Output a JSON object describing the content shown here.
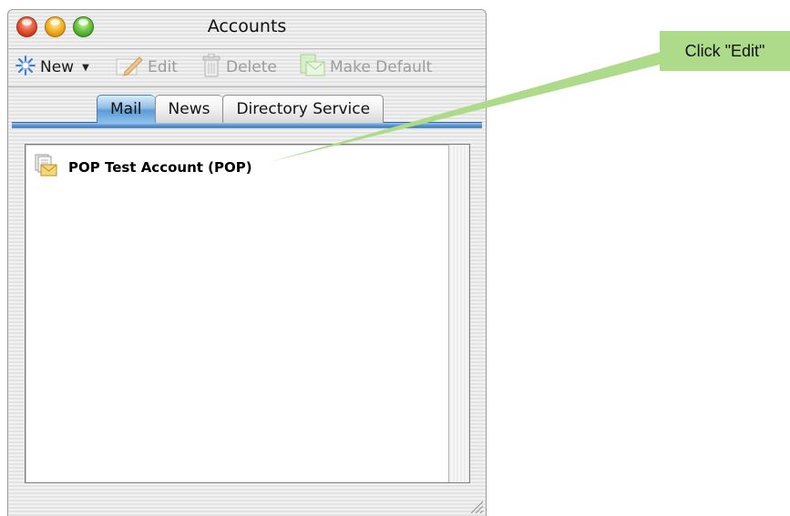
{
  "window": {
    "title": "Accounts"
  },
  "toolbar": {
    "new_label": "New",
    "edit_label": "Edit",
    "delete_label": "Delete",
    "make_default_label": "Make Default",
    "new_icon": "new-sparkle-icon",
    "edit_icon": "edit-icon",
    "delete_icon": "trash-icon",
    "make_default_icon": "make-default-icon"
  },
  "tabs": [
    {
      "label": "Mail",
      "active": true
    },
    {
      "label": "News",
      "active": false
    },
    {
      "label": "Directory Service",
      "active": false
    }
  ],
  "accounts": [
    {
      "name": "POP Test Account (POP)",
      "icon": "mail-account-icon"
    }
  ],
  "annotation": {
    "text": "Click \"Edit\"",
    "color": "#addb8a"
  },
  "colors": {
    "tab_accent": "#5d9cd5",
    "callout": "#addb8a"
  }
}
